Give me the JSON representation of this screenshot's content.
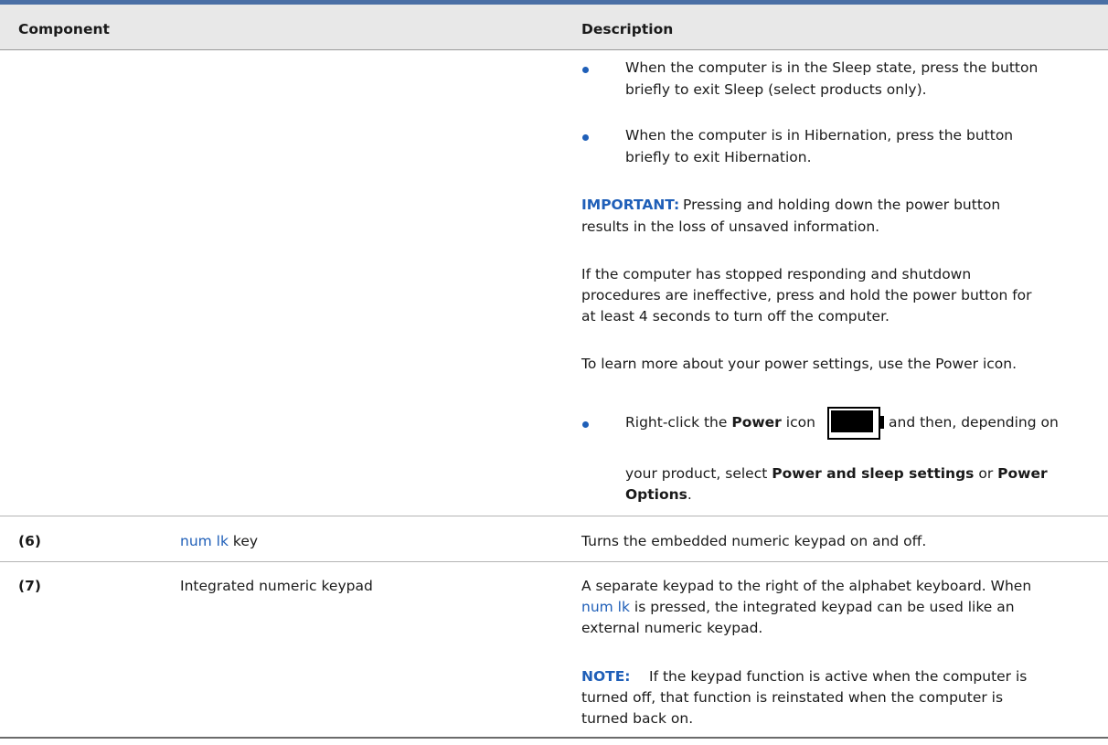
{
  "table": {
    "headers": {
      "component": "Component",
      "description": "Description"
    },
    "power_rows": {
      "bullet_sleep_1": "When the computer is in the Sleep state, press the button",
      "bullet_sleep_2": "briefly to exit Sleep (select products only).",
      "bullet_hib_1": "When the computer is in Hibernation, press the button",
      "bullet_hib_2": "briefly to exit Hibernation.",
      "important_label": "IMPORTANT:",
      "important_1": "Pressing and holding down the power button",
      "important_2": "results in the loss of unsaved information.",
      "stopped_1": "If the computer has stopped responding and shutdown",
      "stopped_2": "procedures are ineffective, press and hold the power button for",
      "stopped_3": "at least 4 seconds to turn off the computer.",
      "learn_more": "To learn more about your power settings, use the Power icon.",
      "right_click_pre": "Right-click the",
      "right_click_power": "Power",
      "right_click_icon": "icon",
      "right_click_post": "and then, depending on",
      "select_pre": "your product, select",
      "select_option_1": "Power and sleep settings",
      "select_or": "or",
      "select_option_2a": "Power",
      "select_option_2b": "Options",
      "select_period": "."
    },
    "row6": {
      "number": "(6)",
      "key_name": "num lk",
      "key_suffix": "key",
      "description": "Turns the embedded numeric keypad on and off."
    },
    "row7": {
      "number": "(7)",
      "component": "Integrated numeric keypad",
      "desc_1": "A separate keypad to the right of the alphabet keyboard. When",
      "desc_2_key": "num lk",
      "desc_2_rest": "is pressed, the integrated keypad can be used like an",
      "desc_3": "external numeric keypad.",
      "note_label": "NOTE:",
      "note_1": "If the keypad function is active when the computer is",
      "note_2": "turned off, that function is reinstated when the computer is",
      "note_3": "turned back on."
    }
  },
  "icons": {
    "power_icon": "battery-icon"
  },
  "colors": {
    "accent_blue": "#1f5fb8",
    "header_bg": "#e8e8e8",
    "top_rule": "#4a6fa5"
  }
}
